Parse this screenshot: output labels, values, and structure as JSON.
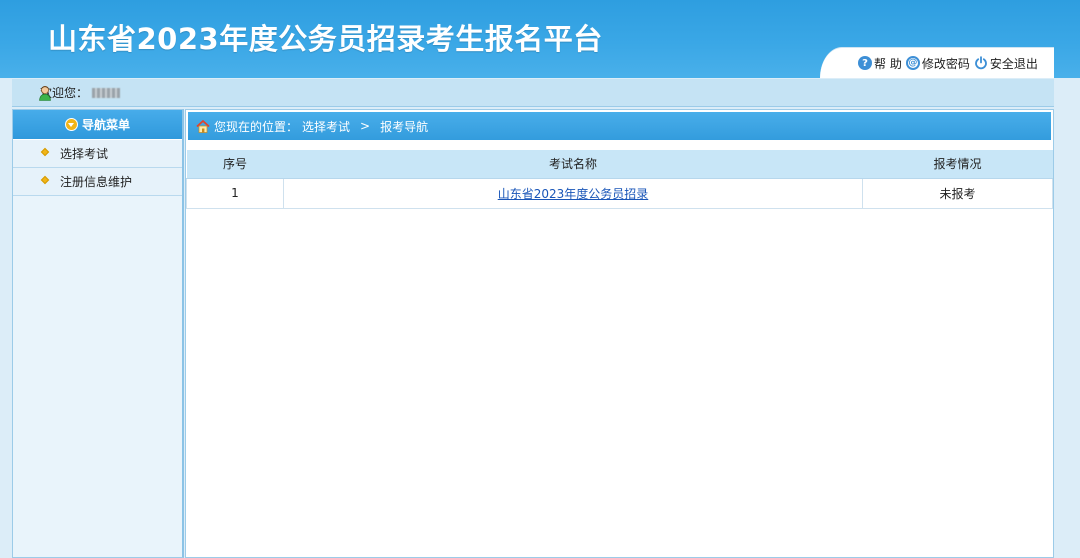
{
  "header": {
    "title": "山东省2023年度公务员招录考生报名平台",
    "toolbar": {
      "help": "帮 助",
      "change_password": "修改密码",
      "logout": "安全退出"
    }
  },
  "welcome": {
    "label": "欢迎您："
  },
  "sidebar": {
    "title": "导航菜单",
    "items": [
      {
        "label": "选择考试"
      },
      {
        "label": "注册信息维护"
      }
    ]
  },
  "breadcrumb": {
    "prefix": "您现在的位置：",
    "path": [
      "选择考试",
      "报考导航"
    ],
    "separator": ">"
  },
  "exam_table": {
    "columns": [
      "序号",
      "考试名称",
      "报考情况"
    ],
    "rows": [
      {
        "index": "1",
        "name": "山东省2023年度公务员招录",
        "status": "未报考"
      }
    ]
  },
  "colors": {
    "header_blue": "#3aa7e6",
    "bar_blue": "#339cdd",
    "table_head": "#c8e6f7",
    "link": "#1a56b8"
  }
}
